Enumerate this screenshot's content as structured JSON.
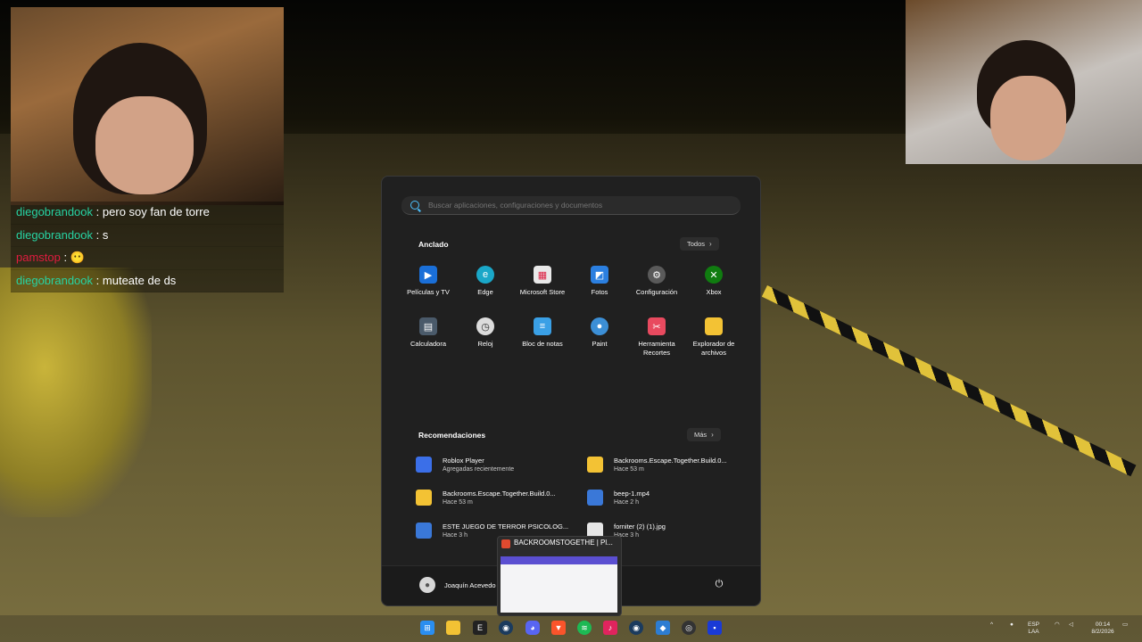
{
  "chat": {
    "lines": [
      {
        "user": "diegobrandook",
        "message": "pero soy fan de torre",
        "color": "#27d3a3"
      },
      {
        "user": "diegobrandook",
        "message": "s",
        "color": "#27d3a3"
      },
      {
        "user": "pamstop",
        "message": "😶",
        "color": "#e01c3f"
      },
      {
        "user": "diegobrandook",
        "message": "muteate de ds",
        "color": "#27d3a3"
      }
    ],
    "separator": ":"
  },
  "start_menu": {
    "search_placeholder": "Buscar aplicaciones, configuraciones y documentos",
    "pinned_title": "Anclado",
    "all_button": "Todos",
    "pinned_apps": [
      {
        "label": "Películas y TV",
        "icon": "film-icon",
        "color": "#1a6fd8"
      },
      {
        "label": "Edge",
        "icon": "edge-icon",
        "color": "#1aa7c8"
      },
      {
        "label": "Microsoft Store",
        "icon": "store-icon",
        "color": "#e9e9e9"
      },
      {
        "label": "Fotos",
        "icon": "photos-icon",
        "color": "#2b7fe0"
      },
      {
        "label": "Configuración",
        "icon": "gear-icon",
        "color": "#5a5a5a"
      },
      {
        "label": "Xbox",
        "icon": "xbox-icon",
        "color": "#107c10"
      },
      {
        "label": "Calculadora",
        "icon": "calculator-icon",
        "color": "#4a5a6a"
      },
      {
        "label": "Reloj",
        "icon": "clock-icon",
        "color": "#dcdcdc"
      },
      {
        "label": "Bloc de notas",
        "icon": "notepad-icon",
        "color": "#3aa0e6"
      },
      {
        "label": "Paint",
        "icon": "paint-icon",
        "color": "#3c8fd6"
      },
      {
        "label": "Herramienta Recortes",
        "icon": "snipping-icon",
        "color": "#e84a5f"
      },
      {
        "label": "Explorador de archivos",
        "icon": "folder-icon",
        "color": "#f3c234"
      }
    ],
    "recommended_title": "Recomendaciones",
    "more_button": "Más",
    "recommended": [
      {
        "name": "Roblox Player",
        "time": "Agregadas recientemente",
        "icon": "roblox-icon",
        "color": "#3b6fe8"
      },
      {
        "name": "Backrooms.Escape.Together.Build.0...",
        "time": "Hace 53 m",
        "icon": "folder-icon",
        "color": "#f3c234"
      },
      {
        "name": "Backrooms.Escape.Together.Build.0...",
        "time": "Hace 53 m",
        "icon": "folder-icon",
        "color": "#f3c234"
      },
      {
        "name": "beep-1.mp4",
        "time": "Hace 2 h",
        "icon": "video-file-icon",
        "color": "#3a78d8"
      },
      {
        "name": "ESTE JUEGO DE TERROR PSICOLOG...",
        "time": "Hace 3 h",
        "icon": "document-icon",
        "color": "#3a78d8"
      },
      {
        "name": "forniter (2) (1).jpg",
        "time": "Hace 3 h",
        "icon": "image-file-icon",
        "color": "#e6e6e6"
      }
    ],
    "user_name": "Joaquín Acevedo"
  },
  "preview": {
    "title": "BACKROOMSTOGETHE | Pl..."
  },
  "taskbar": {
    "icons": [
      "windows-icon",
      "file-explorer-icon",
      "epic-games-icon",
      "steam-icon",
      "discord-icon",
      "brave-icon",
      "spotify-icon",
      "tiktok-icon",
      "steam-icon",
      "defender-icon",
      "obs-icon",
      "app-icon"
    ],
    "lang": "ESP",
    "lang2": "LAA",
    "time": "00:14",
    "date": "8/2/2026"
  }
}
